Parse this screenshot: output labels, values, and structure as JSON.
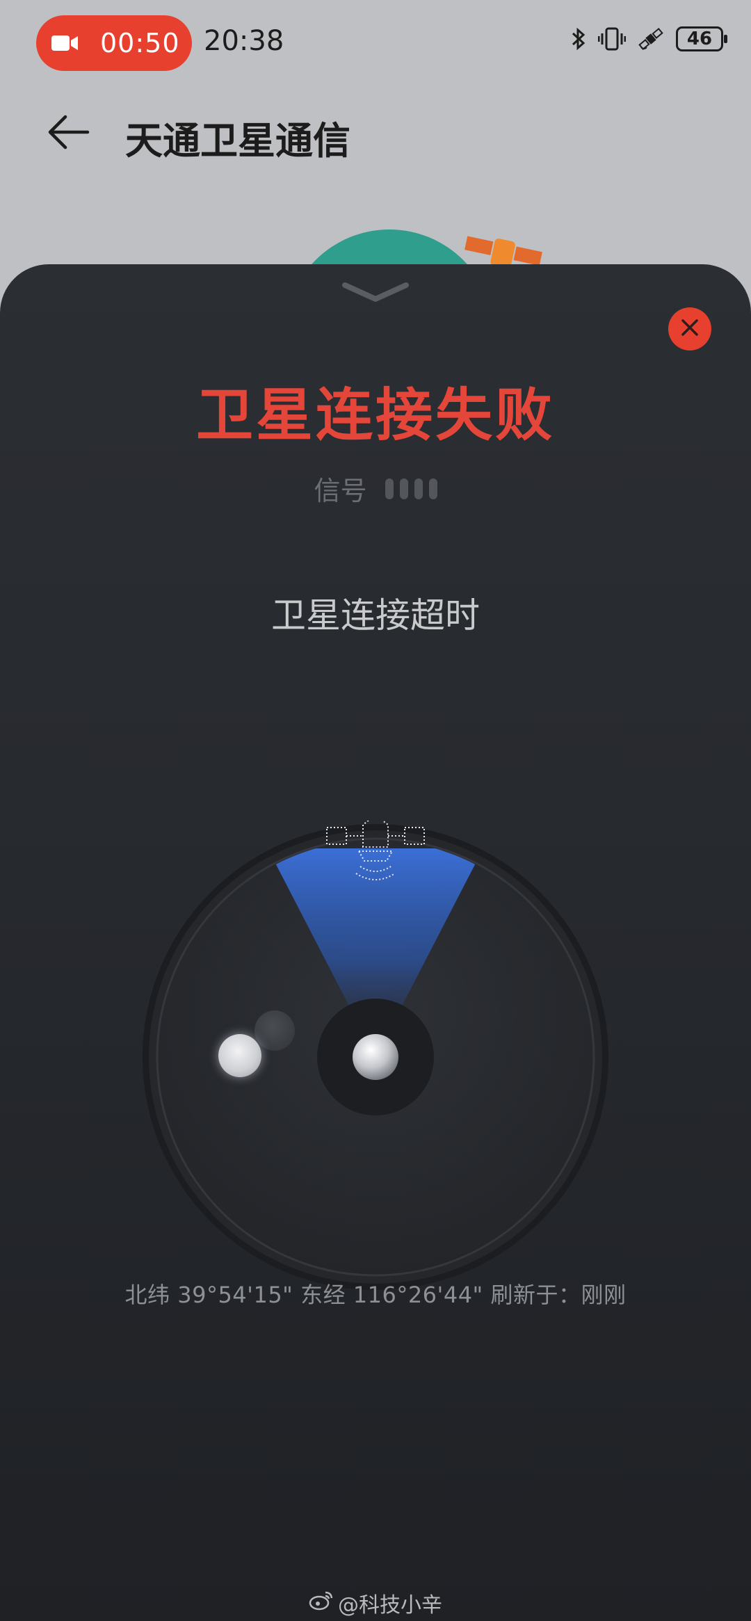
{
  "status_bar": {
    "recording_time": "00:50",
    "clock": "20:38",
    "battery": "46",
    "recording_color": "#e8402f",
    "icons": [
      "video-camera-icon",
      "bluetooth-icon",
      "vibrate-icon",
      "satellite-icon",
      "battery-icon"
    ]
  },
  "header": {
    "title": "天通卫星通信",
    "back_icon": "back-arrow-icon"
  },
  "sheet": {
    "collapse_icon": "chevron-down-icon",
    "close_icon": "close-icon",
    "status_title": "卫星连接失败",
    "signal_label": "信号",
    "signal_bars_active": 0,
    "signal_bars_total": 4,
    "message": "卫星连接超时",
    "coordinates": "北纬 39°54'15\" 东经 116°26'44\" 刷新于：刚刚",
    "accent_color": "#e4463a",
    "beam_color": "#3b6fd6"
  },
  "watermark": {
    "text": "@科技小辛",
    "icon": "weibo-icon"
  }
}
